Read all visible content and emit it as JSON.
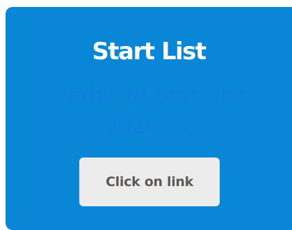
{
  "card": {
    "title": "Start List",
    "link_text_line1": "Derby Tri Start list",
    "link_text_line2": "2024 v2",
    "button_label": "Click on link"
  },
  "colors": {
    "card_background": "#0a86d6",
    "title": "#ffffff",
    "link_text": "#0f7fde",
    "button_background": "#ececec",
    "button_text": "#5d5a55"
  }
}
